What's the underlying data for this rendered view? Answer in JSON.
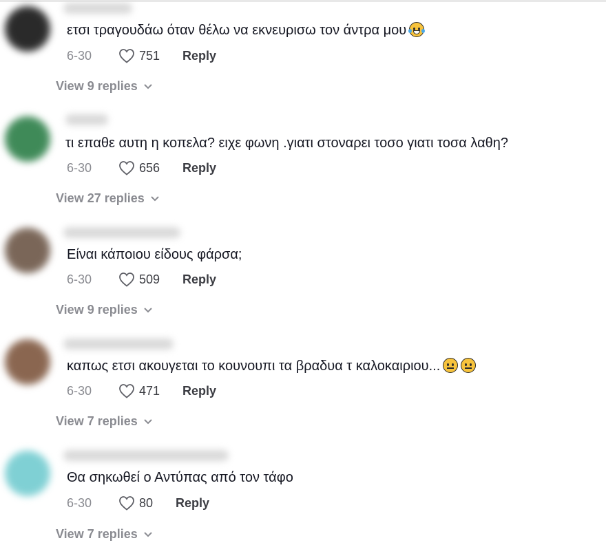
{
  "comments": [
    {
      "text": "ετσι τραγουδάω όταν θέλω να εκνευρισω τον άντρα μου",
      "emoji": [
        "laugh"
      ],
      "date": "6-30",
      "likes": "751",
      "reply": "Reply",
      "view_replies": "View 9 replies",
      "avatar_color": "#2a2a2a"
    },
    {
      "text": "τι επαθε αυτη η κοπελα? ειχε φωνη .γιατι στοναρει τοσο γιατι τοσα λαθη?",
      "emoji": [],
      "date": "6-30",
      "likes": "656",
      "reply": "Reply",
      "view_replies": "View 27 replies",
      "avatar_color": "#3f8a58"
    },
    {
      "text": "Είναι κάποιου είδους φάρσα;",
      "emoji": [],
      "date": "6-30",
      "likes": "509",
      "reply": "Reply",
      "view_replies": "View 9 replies",
      "avatar_color": "#7a6658"
    },
    {
      "text": "καπως ετσι ακουγεται το κουνουπι τα βραδυα τ καλοκαιριου...",
      "emoji": [
        "neutral",
        "neutral"
      ],
      "date": "6-30",
      "likes": "471",
      "reply": "Reply",
      "view_replies": "View 7 replies",
      "avatar_color": "#8a6650"
    },
    {
      "text": "Θα σηκωθεί ο Αντύπας από τον τάφο",
      "emoji": [],
      "date": "6-30",
      "likes": "80",
      "reply": "Reply",
      "view_replies": "View 7 replies",
      "avatar_color": "#7fd0d4"
    }
  ]
}
